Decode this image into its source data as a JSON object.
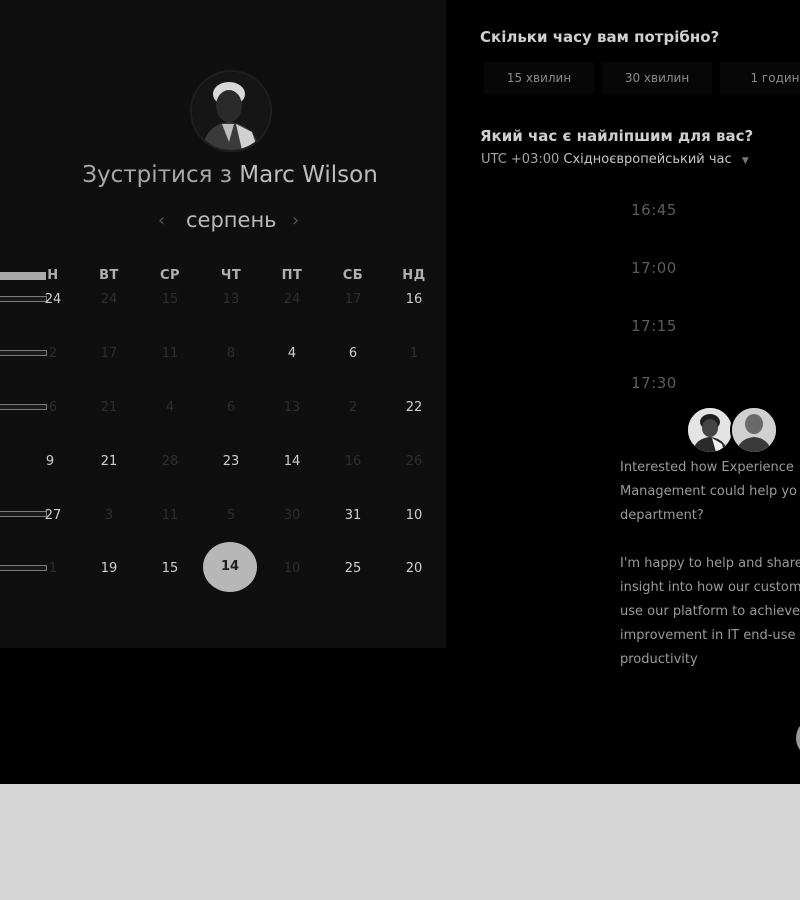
{
  "header": {
    "title_prefix": "Зустрітися з",
    "title_name": "Marc Wilson"
  },
  "calendar": {
    "month": "серпень",
    "prev_icon": "‹",
    "next_icon": "›",
    "dow_partial": "Н",
    "dow": [
      "ВТ",
      "СР",
      "ЧТ",
      "ПТ",
      "СБ",
      "НД"
    ],
    "rows": [
      {
        "first": "24",
        "cells": [
          "24",
          "15",
          "13",
          "24",
          "17",
          "16"
        ],
        "dim": [
          true,
          true,
          true,
          true,
          true,
          false
        ]
      },
      {
        "first": "2",
        "cells": [
          "17",
          "11",
          "8",
          "4",
          "6",
          "1"
        ],
        "dim": [
          true,
          true,
          true,
          false,
          false,
          true
        ]
      },
      {
        "first": "6",
        "cells": [
          "21",
          "4",
          "6",
          "13",
          "2",
          "22"
        ],
        "dim": [
          true,
          true,
          true,
          true,
          true,
          false
        ]
      },
      {
        "first": "9",
        "cells": [
          "21",
          "28",
          "23",
          "14",
          "16",
          "26"
        ],
        "dim": [
          false,
          true,
          false,
          false,
          true,
          true
        ]
      },
      {
        "first": "27",
        "cells": [
          "3",
          "11",
          "5",
          "30",
          "31",
          "10"
        ],
        "dim": [
          true,
          true,
          true,
          true,
          false,
          false
        ]
      },
      {
        "first": "1",
        "cells": [
          "19",
          "15",
          "14",
          "10",
          "25",
          "20"
        ],
        "dim": [
          false,
          false,
          false,
          true,
          false,
          false
        ]
      }
    ],
    "selected_day": "14"
  },
  "duration": {
    "question": "Скільки часу вам потрібно?",
    "options": [
      "15 хвилин",
      "30 хвилин",
      "1 годин"
    ]
  },
  "time": {
    "question": "Який час є найліпшим для вас?",
    "tz_offset": "UTC +03:00",
    "tz_name": "Східноєвропейський час",
    "slots": [
      "16:45",
      "17:00",
      "17:15",
      "17:30"
    ]
  },
  "chat": {
    "lines": [
      "Interested how Experience",
      "Management could help yo",
      "department?",
      "",
      "I'm happy to help and share",
      "insight into how our custom",
      "use our platform to achieve",
      "improvement in IT end-use",
      "productivity"
    ]
  },
  "icons": {
    "host_avatar": "person-avatar-icon",
    "chat_avatars": "team-avatar-icon",
    "dropdown": "caret-down-icon",
    "launcher": "chat-launcher-icon"
  }
}
